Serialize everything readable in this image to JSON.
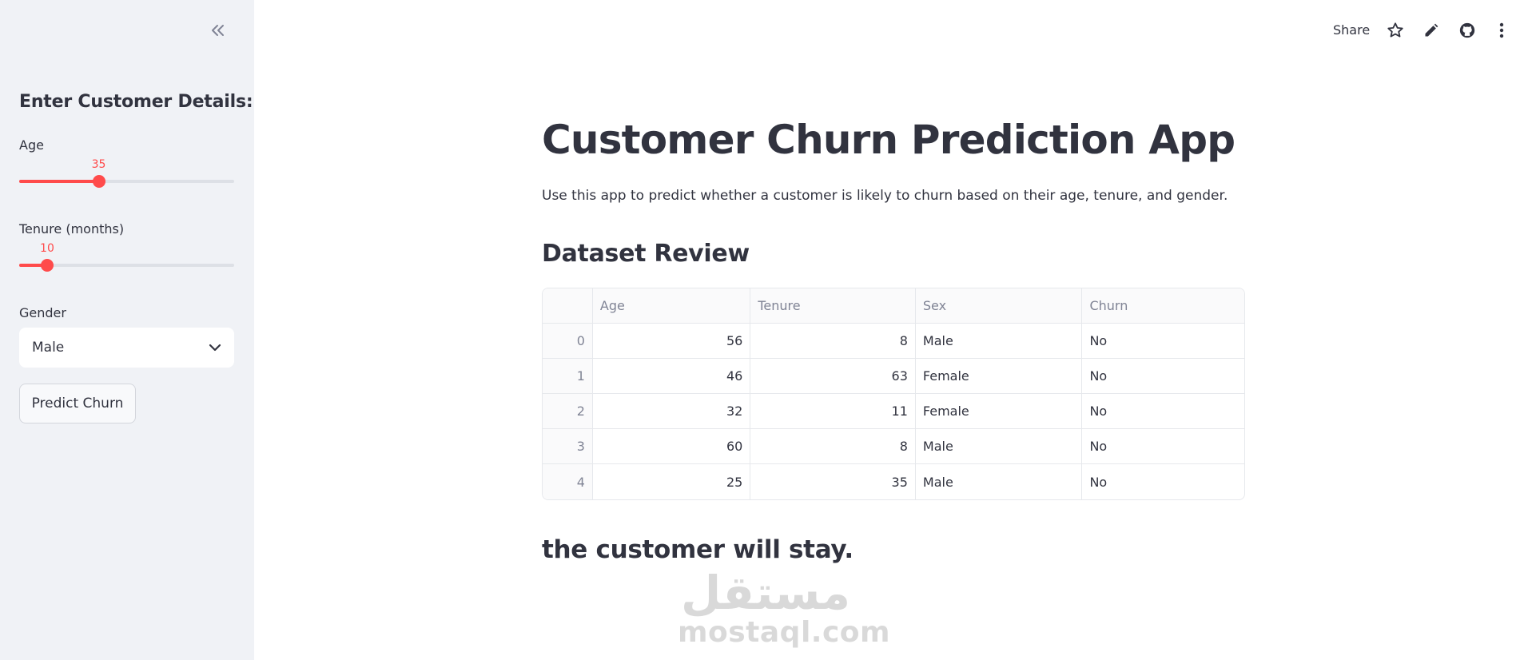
{
  "sidebar": {
    "heading": "Enter Customer Details:",
    "age": {
      "label": "Age",
      "value": "35",
      "fraction": 0.37
    },
    "tenure": {
      "label": "Tenure (months)",
      "value": "10",
      "fraction": 0.13
    },
    "gender": {
      "label": "Gender",
      "selected": "Male"
    },
    "predict_button": "Predict Churn"
  },
  "header": {
    "share_label": "Share",
    "icons": [
      "star-icon",
      "pencil-icon",
      "github-icon",
      "more-vert-icon"
    ]
  },
  "main": {
    "title": "Customer Churn Prediction App",
    "intro": "Use this app to predict whether a customer is likely to churn based on their age, tenure, and gender.",
    "dataset_heading": "Dataset Review",
    "table": {
      "columns": [
        "",
        "Age",
        "Tenure",
        "Sex",
        "Churn"
      ],
      "rows": [
        [
          "0",
          "56",
          "8",
          "Male",
          "No"
        ],
        [
          "1",
          "46",
          "63",
          "Female",
          "No"
        ],
        [
          "2",
          "32",
          "11",
          "Female",
          "No"
        ],
        [
          "3",
          "60",
          "8",
          "Male",
          "No"
        ],
        [
          "4",
          "25",
          "35",
          "Male",
          "No"
        ]
      ]
    },
    "result": "the customer will stay."
  },
  "watermark": {
    "arabic": "مستقل",
    "latin": "mostaql.com"
  },
  "colors": {
    "accent": "#FF4B4B",
    "sidebar_bg": "#F0F2F6",
    "text": "#31333F",
    "muted": "#808495"
  }
}
